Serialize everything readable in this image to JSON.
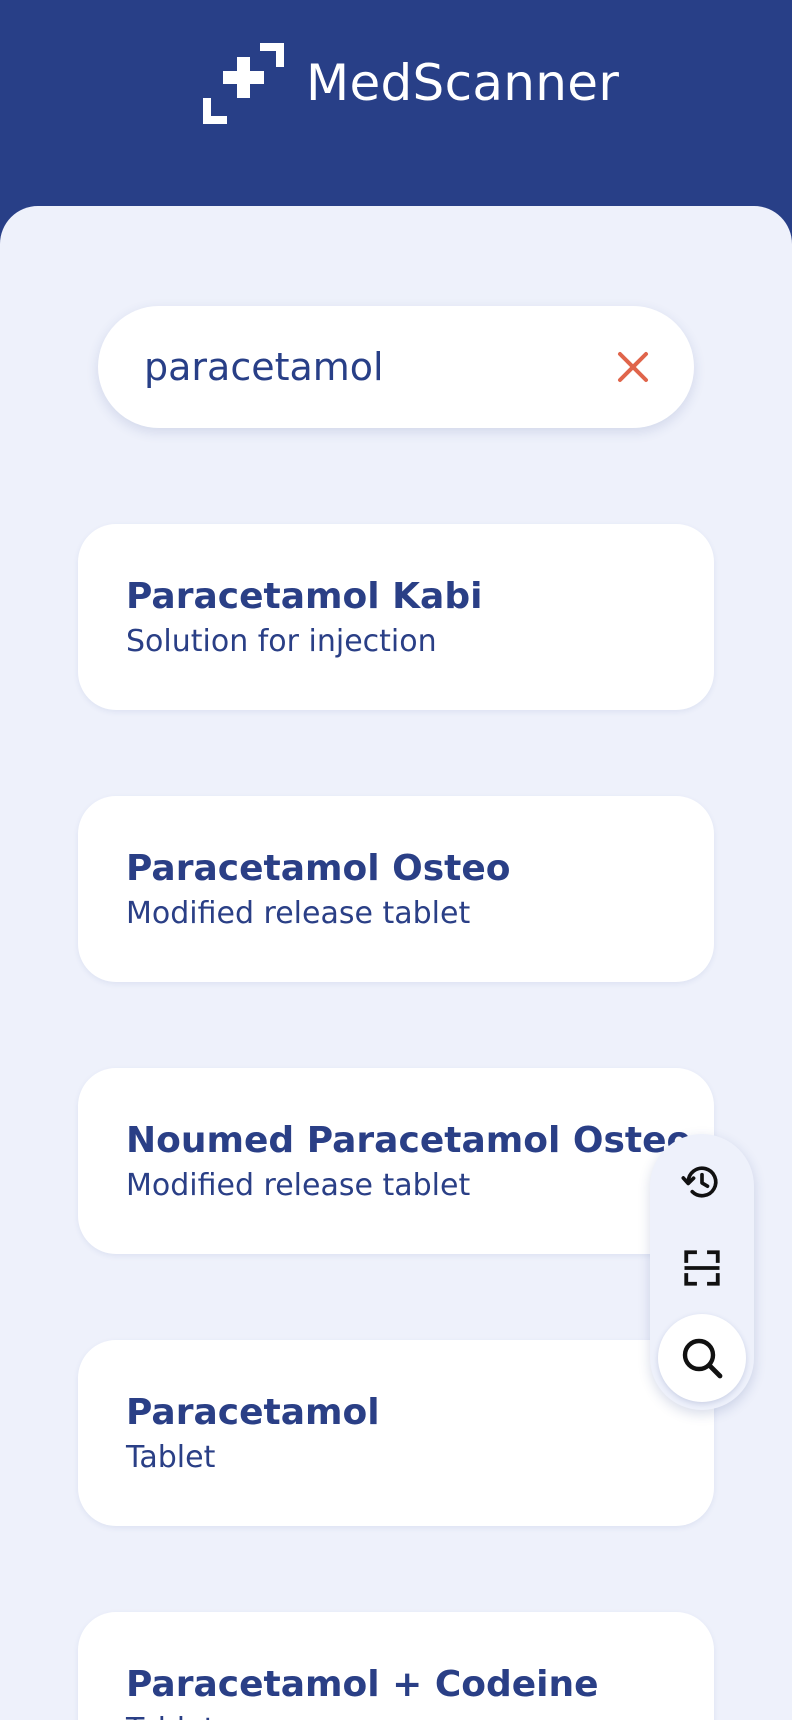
{
  "app": {
    "name": "MedScanner"
  },
  "search": {
    "value": "paracetamol"
  },
  "results": [
    {
      "name": "Paracetamol Kabi",
      "form": "Solution for injection"
    },
    {
      "name": "Paracetamol Osteo",
      "form": "Modified release tablet"
    },
    {
      "name": "Noumed Paracetamol Osteo",
      "form": "Modified release tablet"
    },
    {
      "name": "Paracetamol",
      "form": "Tablet"
    },
    {
      "name": "Paracetamol + Codeine",
      "form": "Tablet"
    }
  ],
  "actions": {
    "history_icon": "history-icon",
    "scan_icon": "barcode-scan-icon",
    "search_icon": "search-icon"
  },
  "colors": {
    "brand_navy": "#283f87",
    "background": "#eef1fb",
    "card": "#ffffff",
    "clear_accent": "#e0654b"
  }
}
